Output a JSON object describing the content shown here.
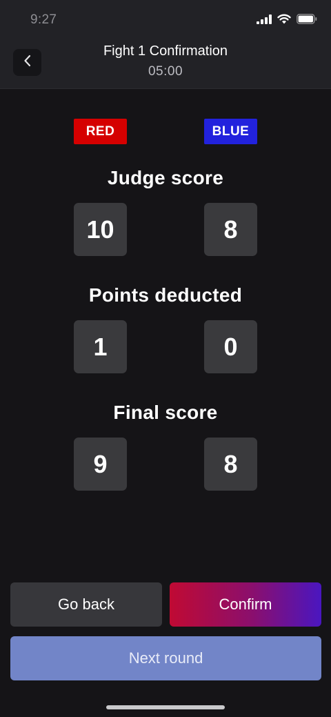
{
  "status_bar": {
    "time": "9:27",
    "icons": [
      "cellular-signal-icon",
      "wifi-icon",
      "battery-icon"
    ]
  },
  "header": {
    "title": "Fight 1 Confirmation",
    "subtitle": "05:00",
    "back_icon": "chevron-left-icon"
  },
  "corners": {
    "red_label": "RED",
    "blue_label": "BLUE",
    "red_color": "#d50000",
    "blue_color": "#2222dd"
  },
  "judge_score": {
    "title": "Judge score",
    "red": "10",
    "blue": "8"
  },
  "points_deducted": {
    "title": "Points deducted",
    "red": "1",
    "blue": "0"
  },
  "final_score": {
    "title": "Final score",
    "red": "9",
    "blue": "8"
  },
  "actions": {
    "go_back_label": "Go back",
    "confirm_label": "Confirm",
    "next_round_label": "Next round"
  }
}
